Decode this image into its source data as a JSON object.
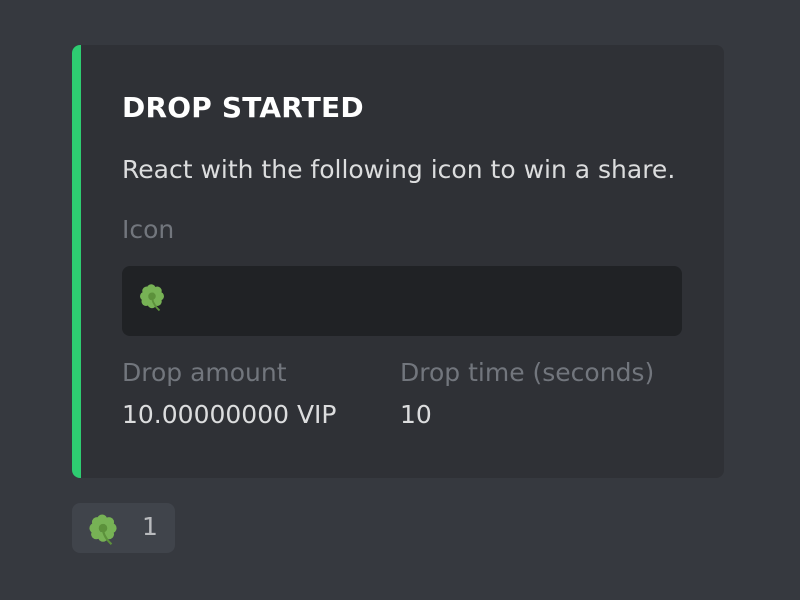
{
  "embed": {
    "accent_color": "#2ecc71",
    "title": "DROP STARTED",
    "description": "React with the following icon to win a share.",
    "icon_field": {
      "name": "Icon",
      "value_icon": "four-leaf-clover-icon"
    },
    "fields": [
      {
        "name": "Drop amount",
        "value": "10.00000000 VIP"
      },
      {
        "name": "Drop time (seconds)",
        "value": "10"
      }
    ]
  },
  "reaction": {
    "icon": "four-leaf-clover-icon",
    "count": "1"
  }
}
